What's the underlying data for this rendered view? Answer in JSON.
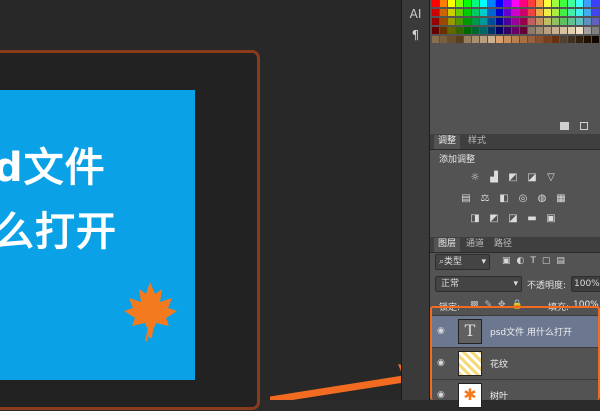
{
  "canvas": {
    "art_line1": "d文件",
    "art_line2": "么打开"
  },
  "toolbar": {
    "type_tool": "AI",
    "paragraph_tool": "¶"
  },
  "adjustments": {
    "tabs": [
      "调整",
      "样式"
    ],
    "add_label": "添加调整"
  },
  "layers_panel": {
    "tabs": [
      "图层",
      "通道",
      "路径"
    ],
    "filter_kind": "类型",
    "blend_mode": "正常",
    "opacity_label": "不透明度:",
    "opacity_value": "100%",
    "lock_label": "锁定:",
    "fill_label": "填充:",
    "fill_value": "100%",
    "layers": [
      {
        "name": "psd文件 用什么打开",
        "type": "text"
      },
      {
        "name": "花纹",
        "type": "pattern"
      },
      {
        "name": "树叶",
        "type": "leaf"
      }
    ]
  },
  "colors": {
    "artboard": "#0aa1e6",
    "leaf": "#f47a20",
    "frame": "#8a3b1c",
    "arrow": "#f26b21",
    "selected_layer": "#6b7890"
  },
  "icons": [
    "eye-icon",
    "lock-icon",
    "text-layer-icon",
    "leaf-icon",
    "brightness-icon",
    "levels-icon",
    "curves-icon",
    "exposure-icon",
    "vibrance-icon",
    "hue-saturation-icon",
    "color-balance-icon"
  ]
}
